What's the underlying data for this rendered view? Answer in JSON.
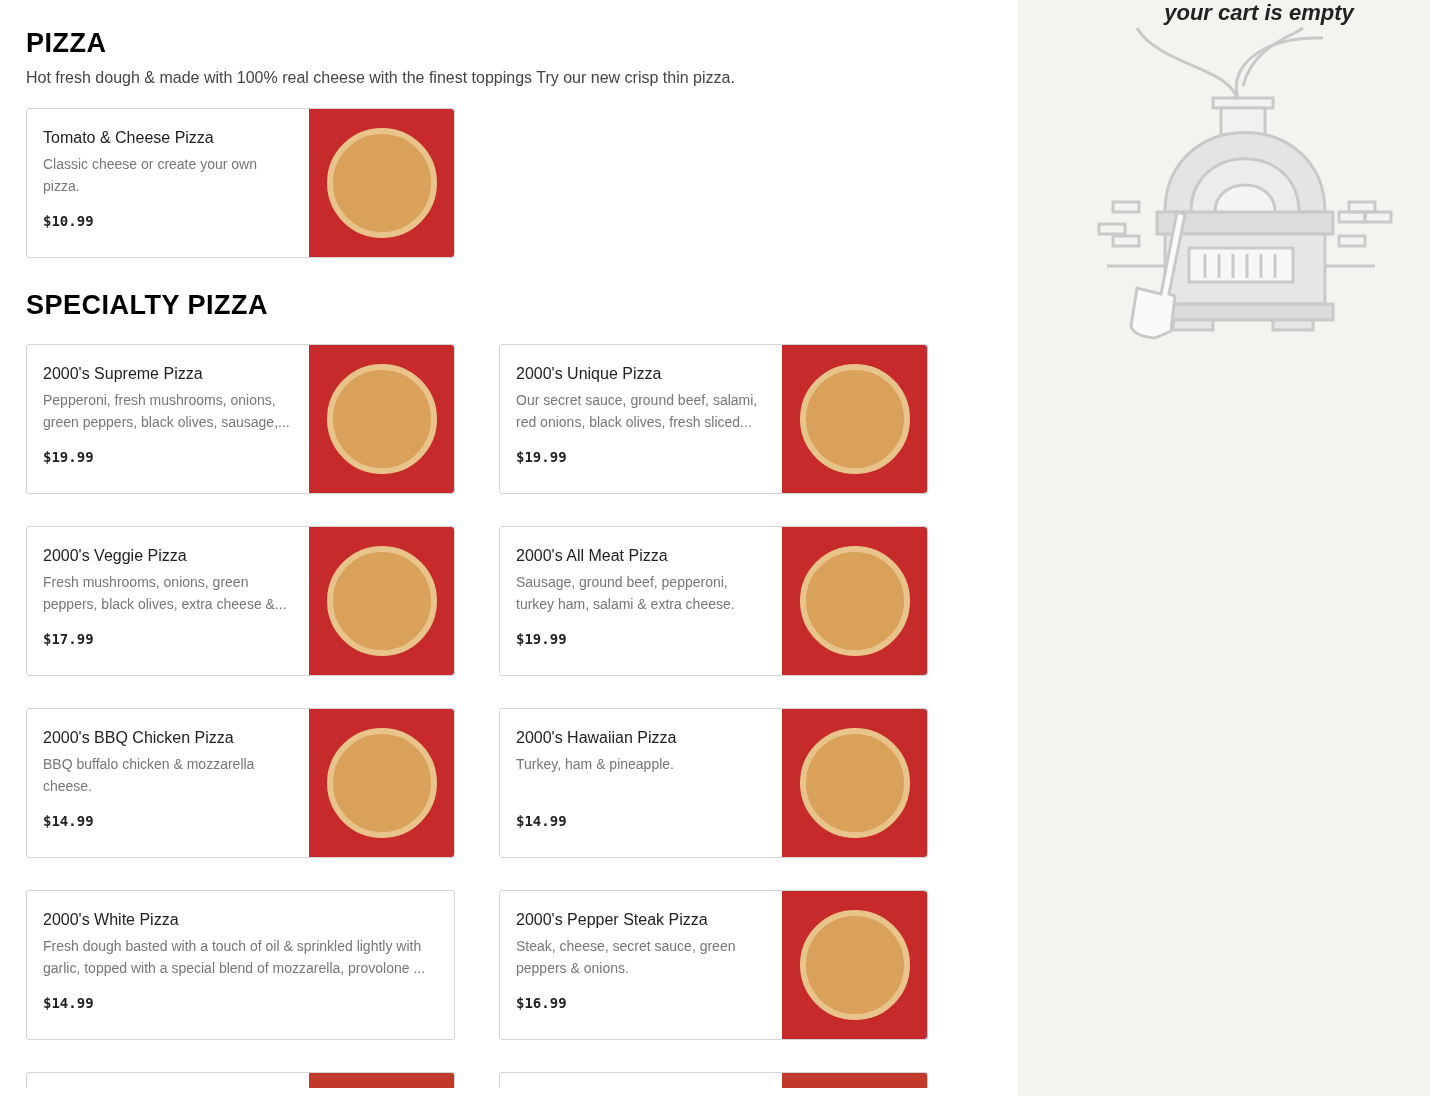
{
  "sections": [
    {
      "title": "PIZZA",
      "description": "Hot fresh dough & made with 100% real cheese with the finest toppings Try our new crisp thin pizza.",
      "items": [
        {
          "kind": "photo",
          "name": "Tomato & Cheese Pizza",
          "description": "Classic cheese or create your own pizza.",
          "price": "$10.99"
        }
      ]
    },
    {
      "title": "SPECIALTY PIZZA",
      "items": [
        {
          "kind": "photo",
          "name": "2000's Supreme Pizza",
          "description": "Pepperoni, fresh mushrooms, onions, green peppers, black olives, sausage,...",
          "price": "$19.99"
        },
        {
          "kind": "photo",
          "name": "2000's Unique Pizza",
          "description": "Our secret sauce, ground beef, salami, red onions, black olives, fresh sliced...",
          "price": "$19.99"
        },
        {
          "kind": "photo",
          "name": "2000's Veggie Pizza",
          "description": "Fresh mushrooms, onions, green peppers, black olives, extra cheese &...",
          "price": "$17.99"
        },
        {
          "kind": "photo",
          "name": "2000's All Meat Pizza",
          "description": "Sausage, ground beef, pepperoni, turkey ham, salami & extra cheese.",
          "price": "$19.99"
        },
        {
          "kind": "photo",
          "name": "2000's BBQ Chicken Pizza",
          "description": "BBQ buffalo chicken & mozzarella cheese.",
          "price": "$14.99"
        },
        {
          "kind": "photo",
          "name": "2000's Hawaiian Pizza",
          "description": "Turkey, ham & pineapple.",
          "price": "$14.99"
        },
        {
          "kind": "text",
          "name": "2000's White Pizza",
          "description": "Fresh dough basted with a touch of oil & sprinkled lightly with garlic, topped with a special blend of mozzarella, provolone ...",
          "price": "$14.99"
        },
        {
          "kind": "photo",
          "name": "2000's Pepper Steak Pizza",
          "description": "Steak, cheese, secret sauce, green peppers & onions.",
          "price": "$16.99"
        }
      ],
      "more": [
        {
          "kind": "photo"
        },
        {
          "kind": "photo"
        }
      ]
    }
  ],
  "cart": {
    "message": "your cart is empty"
  }
}
